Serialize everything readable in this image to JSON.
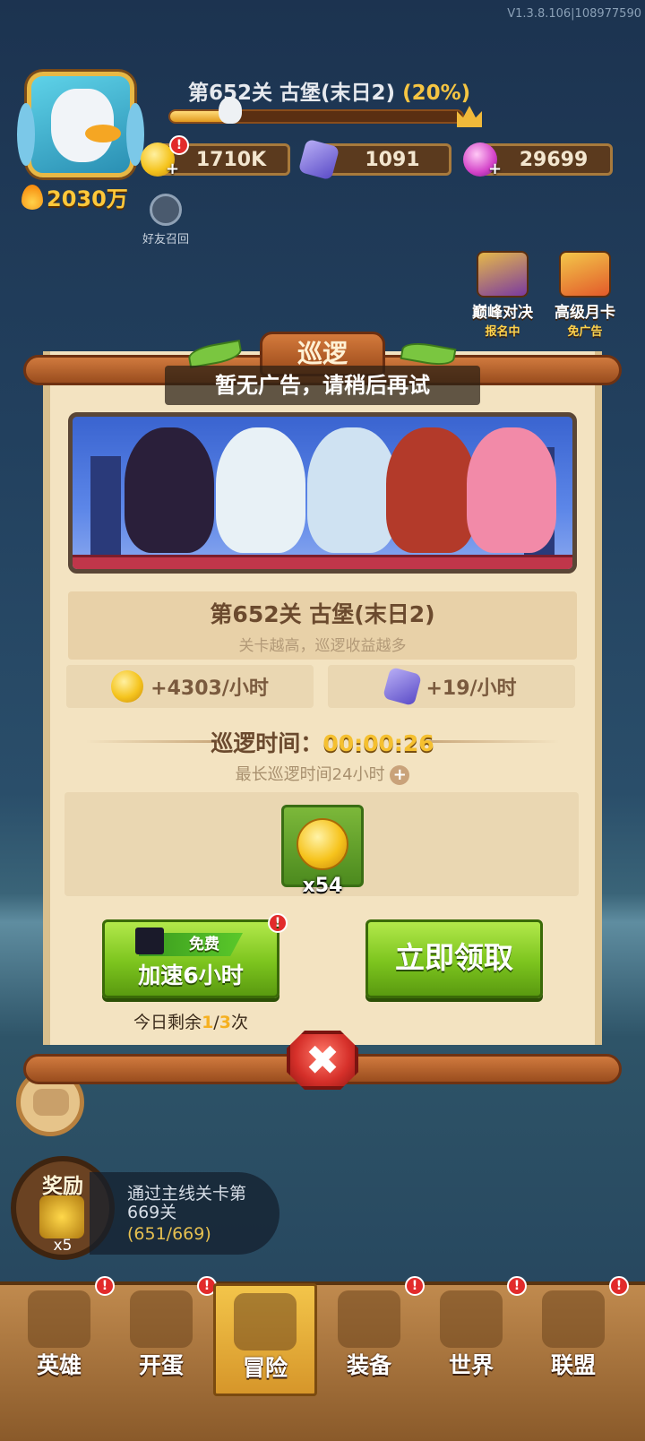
{
  "version": "V1.3.8.106|108977590",
  "player": {
    "power": "2030万"
  },
  "level": {
    "title": "第652关 古堡(末日2)",
    "percent_text": "(20%)",
    "progress": 0.2
  },
  "resources": {
    "gold": "1710K",
    "gems": "1091",
    "orbs": "29699",
    "plus": "+",
    "alert": "!"
  },
  "friend_recall": "好友召回",
  "side_buttons": {
    "peak_title": "巅峰对决",
    "peak_sub": "报名中",
    "monthly_title": "高级月卡",
    "monthly_sub": "免广告"
  },
  "dialog": {
    "title": "巡逻",
    "toast": "暂无广告，请稍后再试",
    "stage_name": "第652关 古堡(末日2)",
    "stage_hint": "关卡越高，巡逻收益越多",
    "gold_rate": "+4303/小时",
    "gem_rate": "+19/小时",
    "patrol_time_label": "巡逻时间：",
    "patrol_time_value": "00:00:26",
    "max_time": "最长巡逻时间24小时",
    "reward_qty": "x54",
    "free_tag": "免费",
    "speed_label": "加速6小时",
    "claim_label": "立即领取",
    "remaining_prefix": "今日剩余",
    "remaining_used": "1",
    "remaining_sep": "/",
    "remaining_total": "3",
    "remaining_suffix": "次",
    "close": "✖"
  },
  "rewards_panel": {
    "title": "奖励",
    "qty": "x5",
    "quest_text": "通过主线关卡第669关",
    "quest_progress": "(651/669)"
  },
  "nav": [
    {
      "label": "英雄",
      "badge": "!"
    },
    {
      "label": "开蛋",
      "badge": "!"
    },
    {
      "label": "冒险",
      "badge": ""
    },
    {
      "label": "装备",
      "badge": "!"
    },
    {
      "label": "世界",
      "badge": "!"
    },
    {
      "label": "联盟",
      "badge": "!"
    }
  ],
  "colors": {
    "accent_gold": "#f5c030",
    "button_green": "#7cc41e",
    "badge_red": "#e22b2b"
  }
}
